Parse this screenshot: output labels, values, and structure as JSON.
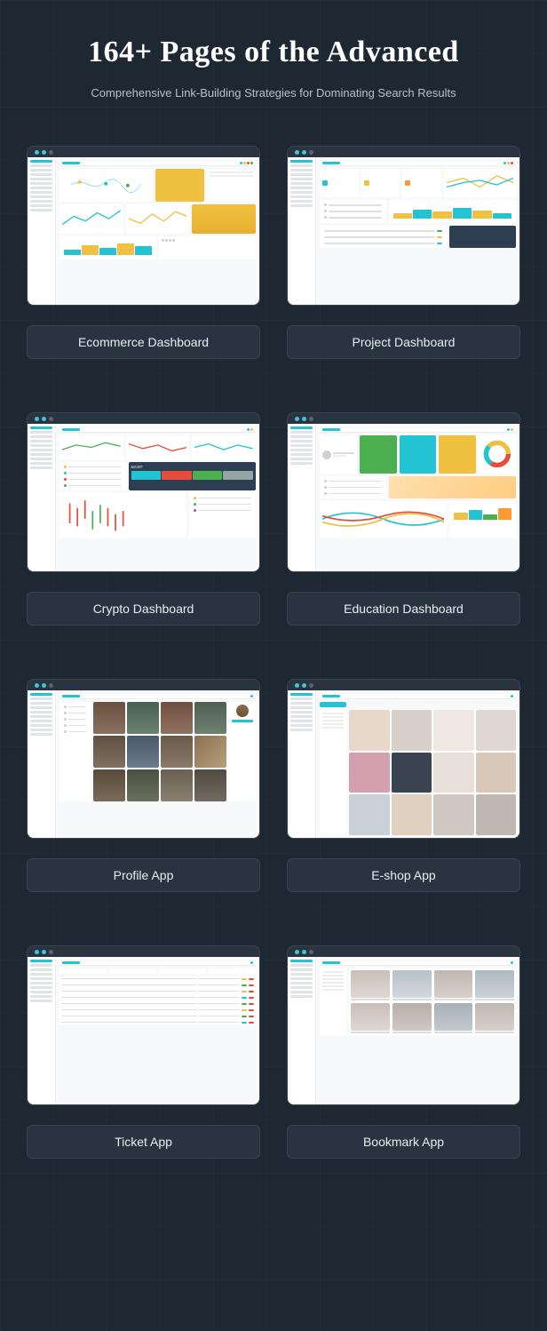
{
  "header": {
    "title": "164+ Pages of the Advanced",
    "subtitle": "Comprehensive Link-Building Strategies for Dominating Search Results"
  },
  "cards": [
    {
      "label": "Ecommerce Dashboard",
      "type": "ecommerce"
    },
    {
      "label": "Project Dashboard",
      "type": "project"
    },
    {
      "label": "Crypto Dashboard",
      "type": "crypto"
    },
    {
      "label": "Education Dashboard",
      "type": "education"
    },
    {
      "label": "Profile App",
      "type": "profile"
    },
    {
      "label": "E-shop App",
      "type": "eshop"
    },
    {
      "label": "Ticket App",
      "type": "ticket"
    },
    {
      "label": "Bookmark App",
      "type": "bookmark"
    }
  ],
  "colors": {
    "cyan": "#22c4d4",
    "yellow": "#f0c040",
    "green": "#4caf50",
    "red": "#e74c3c",
    "orange": "#ff9933",
    "purple": "#9b59b6",
    "blue": "#3498db",
    "dark": "#2c3e50"
  }
}
